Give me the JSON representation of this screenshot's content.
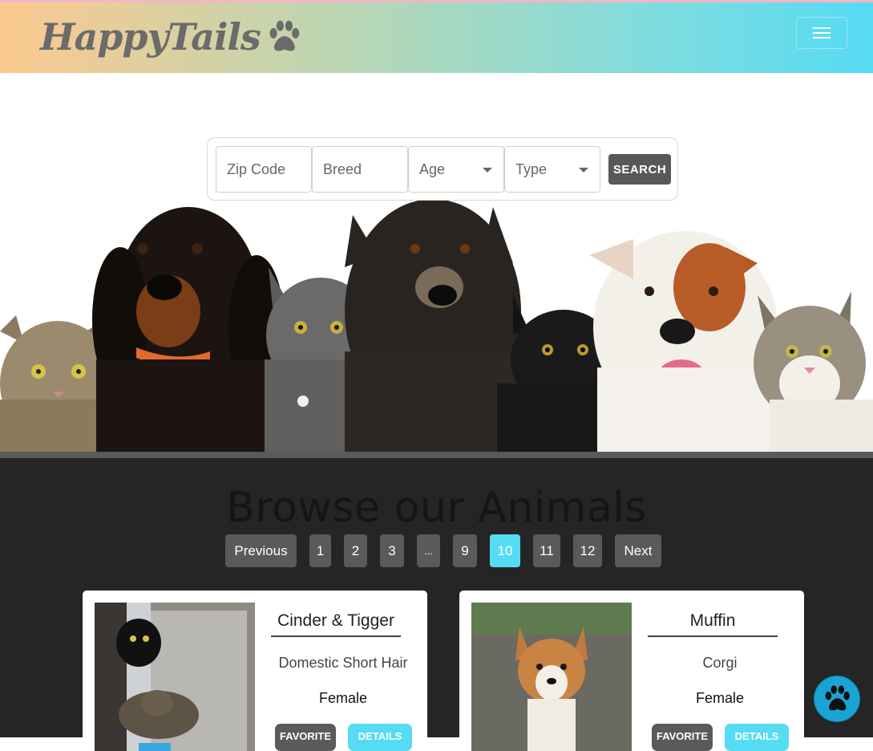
{
  "navbar": {
    "brand": "HappyTails",
    "brand_icon": "paw-icon",
    "menu_icon": "hamburger-menu-icon"
  },
  "search": {
    "zip_placeholder": "Zip Code",
    "breed_placeholder": "Breed",
    "age_label": "Age",
    "type_label": "Type",
    "button_label": "SEARCH"
  },
  "browse": {
    "title": "Browse our Animals"
  },
  "pagination": {
    "previous": "Previous",
    "next": "Next",
    "pages": [
      "1",
      "2",
      "3",
      "...",
      "9",
      "10",
      "11",
      "12"
    ],
    "active": "10"
  },
  "animals": [
    {
      "name": "Cinder & Tigger",
      "breed": "Domestic Short Hair",
      "gender": "Female",
      "favorite_label": "FAVORITE",
      "details_label": "DETAILS"
    },
    {
      "name": "Muffin",
      "breed": "Corgi",
      "gender": "Female",
      "favorite_label": "FAVORITE",
      "details_label": "DETAILS"
    }
  ],
  "colors": {
    "accent": "#55dcf3",
    "button_gray": "#5a5a5a",
    "dark_bg": "#252525"
  }
}
